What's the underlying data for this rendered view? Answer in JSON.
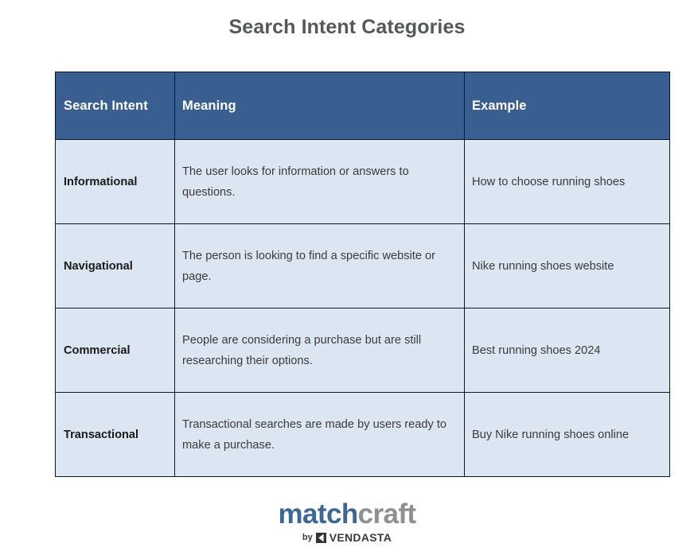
{
  "page": {
    "title": "Search Intent Categories"
  },
  "table": {
    "columns": [
      {
        "key": "intent",
        "label": "Search Intent"
      },
      {
        "key": "meaning",
        "label": "Meaning"
      },
      {
        "key": "example",
        "label": "Example"
      }
    ],
    "rows": [
      {
        "intent": "Informational",
        "meaning": "The user looks for information or answers to questions.",
        "example": "How to choose running shoes"
      },
      {
        "intent": "Navigational",
        "meaning": "The person is looking to find a specific website or page.",
        "example": "Nike running shoes website"
      },
      {
        "intent": "Commercial",
        "meaning": "People are considering a purchase but are still researching their options.",
        "example": "Best running shoes 2024"
      },
      {
        "intent": "Transactional",
        "meaning": "Transactional searches are made by users ready to make a purchase.",
        "example": "Buy Nike running shoes online"
      }
    ]
  },
  "footer": {
    "logo": {
      "brand_first": "match",
      "brand_second": "craft",
      "by_label": "by",
      "parent_brand": "VENDASTA",
      "mark_icon": "vendasta-mark-icon"
    }
  },
  "colors": {
    "header_blue": "#395f91",
    "row_blue": "#dce6f2",
    "border_dark": "#0d1626",
    "title_gray": "#555759",
    "logo_blue": "#3d6795",
    "logo_gray": "#8d8f91"
  }
}
